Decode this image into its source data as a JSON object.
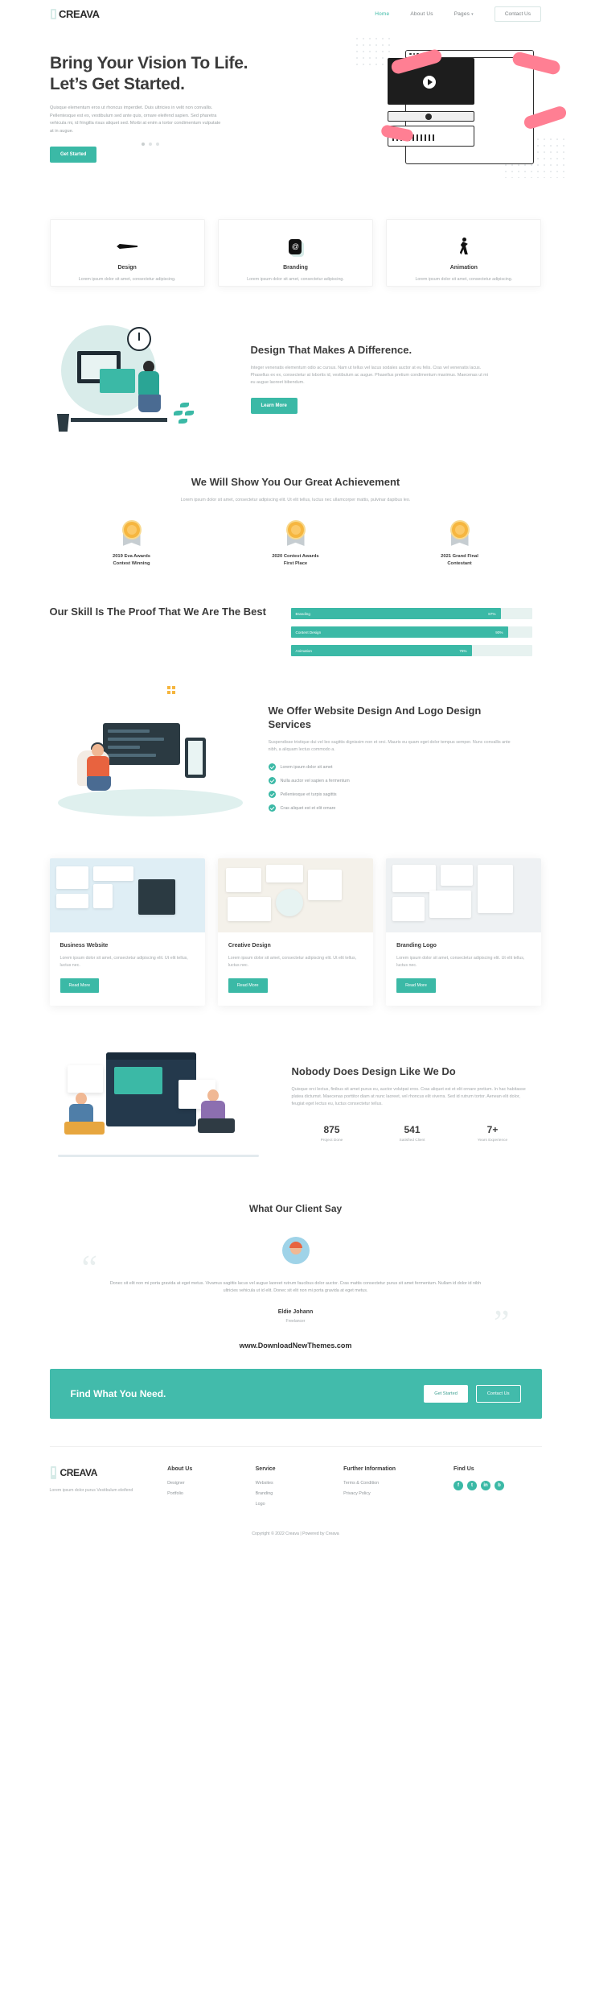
{
  "nav": {
    "brand": "CREAVA",
    "links": [
      {
        "label": "Home",
        "active": true
      },
      {
        "label": "About Us",
        "active": false
      },
      {
        "label": "Pages",
        "active": false,
        "caret": "▾"
      }
    ],
    "cta": "Contact Us"
  },
  "hero": {
    "title": "Bring Your Vision To Life. Let’s Get Started.",
    "paragraph": "Quisque elementum eros ut rhoncus imperdiet. Duis ultricies in velit non convallis. Pellentesque est ex, vestibulum sed ante quis, ornare eleifend sapien. Sed pharetra vehicula mi, id fringilla risus aliquet sed. Morbi at enim a tortor condimentum vulputate at in augue.",
    "button": "Get Started"
  },
  "services": [
    {
      "icon": "pen-icon",
      "title": "Design",
      "desc": "Lorem ipsum dolor sit amet, consectetur adipiscing."
    },
    {
      "icon": "branding-icon",
      "title": "Branding",
      "desc": "Lorem ipsum dolor sit amet, consectetur adipiscing."
    },
    {
      "icon": "animation-icon",
      "title": "Animation",
      "desc": "Lorem ipsum dolor sit amet, consectetur adipiscing."
    }
  ],
  "design_section": {
    "title": "Design That Makes A Difference.",
    "paragraph": "Integer venenatis elementum odio ac cursus. Nam ut tellus vel lacus sodales auctor at eu felis. Cras vel venenatis lacus. Phasellus ex ex, consectetur at lobortis id, vestibulum ac augue. Phasellus pretium condimentum maximus. Maecenas ut mi eu augue laoreet bibendum.",
    "button": "Learn More"
  },
  "achievement": {
    "title": "We Will Show You Our Great Achievement",
    "paragraph": "Lorem ipsum dolor sit amet, consectetur adipiscing elit. Ut elit tellus, luctus nec ullamcorper mattis, pulvinar dapibus leo.",
    "awards": [
      {
        "line1": "2019 Eva Awards",
        "line2": "Contest Winning"
      },
      {
        "line1": "2020 Contest Awards",
        "line2": "First Place"
      },
      {
        "line1": "2021 Grand Final",
        "line2": "Contestant"
      }
    ]
  },
  "skills": {
    "title": "Our Skill Is The Proof That We Are The Best",
    "bars": [
      {
        "label": "Branding",
        "percent": "87%",
        "value": 87
      },
      {
        "label": "Content Design",
        "percent": "90%",
        "value": 90
      },
      {
        "label": "Animation",
        "percent": "75%",
        "value": 75
      }
    ]
  },
  "offer": {
    "title": "We Offer Website Design And Logo Design Services",
    "paragraph": "Suspendisse tristique dui vel leo sagittis dignissim non et orci. Mauris eu quam eget dolor tempus semper. Nunc convallis ante nibh, a aliquam lectus commodo a.",
    "items": [
      "Lorem ipsum dolor sit amet",
      "Nulla auctor vel sapien a fermentum",
      "Pellentesque et turpis sagittis",
      "Cras aliquet est et elit ornare"
    ]
  },
  "portfolio": [
    {
      "title": "Business Website",
      "desc": "Lorem ipsum dolor sit amet, consectetur adipiscing elit. Ut elit tellus, luctus nec.",
      "button": "Read More"
    },
    {
      "title": "Creative Design",
      "desc": "Lorem ipsum dolor sit amet, consectetur adipiscing elit. Ut elit tellus, luctus nec.",
      "button": "Read More"
    },
    {
      "title": "Branding Logo",
      "desc": "Lorem ipsum dolor sit amet, consectetur adipiscing elit. Ut elit tellus, luctus nec.",
      "button": "Read More"
    }
  ],
  "nobody": {
    "title": "Nobody Does Design Like We Do",
    "paragraph": "Quisque orci lectus, finibus sit amet purus eu, auctor volutpat eros. Cras aliquet est et elit ornare pretium. In hac habitasse platea dictumst. Maecenas porttitor diam at nunc laoreet, vel rhoncus elit viverra. Sed id rutrum tortor. Aenean elit dolor, feugiat eget lectus eu, luctus consectetur tellus.",
    "stats": [
      {
        "num": "875",
        "cap": "Project Done"
      },
      {
        "num": "541",
        "cap": "Satisfied Client"
      },
      {
        "num": "7+",
        "cap": "Years Experience"
      }
    ]
  },
  "testimonial": {
    "title": "What Our Client Say",
    "quote_open": "“",
    "quote_close": "”",
    "text": "Donec sit elit non mi porta gravida at eget metus. Vivamus sagittis lacus vel augue laoreet rutrum faucibus dolor auctor. Cras mattis consectetur purus sit amet fermentum. Nullam id dolor id nibh ultricies vehicula ut id elit. Donec sit elit non mi porta gravida at eget metus.",
    "name": "Eldie Johann",
    "role": "Freelancer",
    "url": "www.DownloadNewThemes.com"
  },
  "cta": {
    "title": "Find What You Need.",
    "primary": "Get Started",
    "secondary": "Contact Us"
  },
  "footer": {
    "brand": "CREAVA",
    "tagline": "Lorem ipsum dolor purus Vestibulum eleifend",
    "columns": [
      {
        "heading": "About Us",
        "links": [
          "Designer",
          "Portfolio"
        ]
      },
      {
        "heading": "Service",
        "links": [
          "Websites",
          "Branding",
          "Logo"
        ]
      },
      {
        "heading": "Further Information",
        "links": [
          "Terms & Condition",
          "Privacy Policy"
        ]
      }
    ],
    "find_us": "Find Us",
    "socials": [
      "f",
      "t",
      "in",
      "b"
    ],
    "copyright": "Copyright © 2022 Creava | Powered by Creava"
  },
  "colors": {
    "accent": "#3bb9a6",
    "dark": "#3b3b3b",
    "muted": "#a3a8ab"
  }
}
